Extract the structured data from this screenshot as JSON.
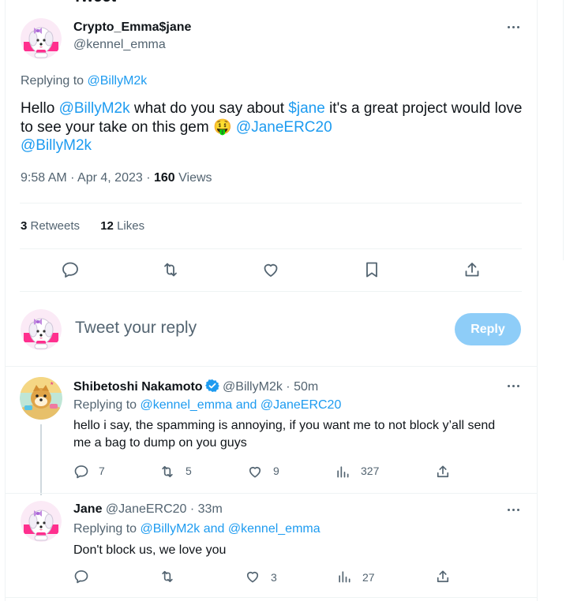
{
  "header": {
    "title": "Tweet"
  },
  "main_tweet": {
    "display_name": "Crypto_Emma$jane",
    "handle": "@kennel_emma",
    "replying_prefix": "Replying to",
    "replying_to": "@BillyM2k",
    "body": {
      "t1": "Hello ",
      "m1": "@BillyM2k",
      "t2": " what do you say about ",
      "m2": "$jane",
      "t3": " it's a great project would love to see your take on this gem ",
      "emoji": "🤑",
      "t4": " ",
      "m3": "@JaneERC20",
      "m4": "@BillyM2k"
    },
    "timestamp": "9:58 AM · Apr 4, 2023 · ",
    "views_count": "160",
    "views_label": " Views",
    "retweets_count": "3",
    "retweets_label": " Retweets",
    "likes_count": "12",
    "likes_label": " Likes",
    "actions": [
      "reply-icon",
      "retweet-icon",
      "like-icon",
      "bookmark-icon",
      "share-icon"
    ]
  },
  "composer": {
    "placeholder": "Tweet your reply",
    "reply_button": "Reply"
  },
  "replies": [
    {
      "display_name": "Shibetoshi Nakamoto",
      "verified": true,
      "handle": "@BillyM2k",
      "time": " · 50m",
      "replying_prefix": "Replying to ",
      "replying_to": "@kennel_emma and @JaneERC20",
      "text": "hello i say, the spamming is annoying, if you want me to not block y’all send me a bag to dump on you guys",
      "reply_count": "7",
      "retweet_count": "5",
      "like_count": "9",
      "view_count": "327"
    },
    {
      "display_name": "Jane",
      "verified": false,
      "handle": "@JaneERC20",
      "time": " · 33m",
      "replying_prefix": "Replying to ",
      "replying_to": "@BillyM2k and @kennel_emma",
      "text": "Don't block us, we love you",
      "reply_count": "",
      "retweet_count": "",
      "like_count": "3",
      "view_count": "27"
    }
  ],
  "colors": {
    "accent": "#1d9bf0",
    "reply_button_disabled": "#8ecdf8",
    "muted_text": "#536471",
    "divider": "#eff3f4"
  }
}
